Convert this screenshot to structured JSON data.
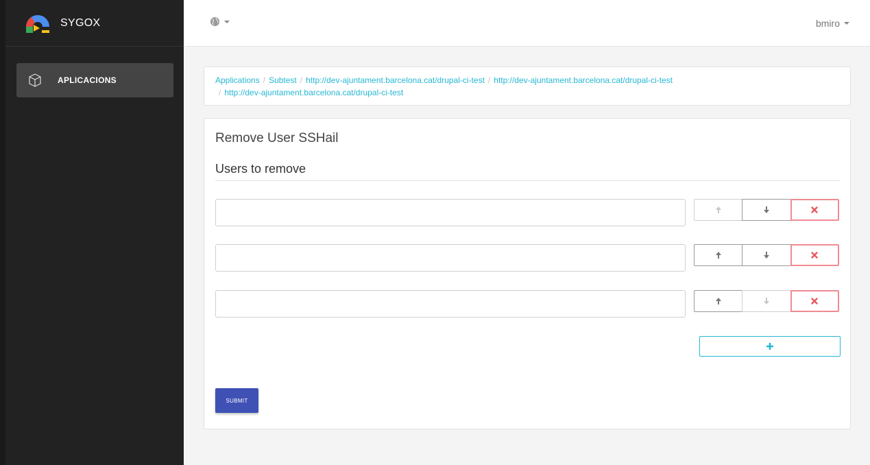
{
  "brand": {
    "name": "SYGOX"
  },
  "sidebar": {
    "items": [
      {
        "label": "APLICACIONS",
        "icon": "cube-icon"
      }
    ]
  },
  "topbar": {
    "language_icon": "globe-icon",
    "user": "bmiro"
  },
  "breadcrumb": [
    "Applications",
    "Subtest",
    "http://dev-ajuntament.barcelona.cat/drupal-ci-test",
    "http://dev-ajuntament.barcelona.cat/drupal-ci-test",
    "http://dev-ajuntament.barcelona.cat/drupal-ci-test"
  ],
  "form": {
    "title": "Remove User SSHail",
    "section": "Users to remove",
    "rows": [
      {
        "value": "",
        "up_enabled": false,
        "down_enabled": true
      },
      {
        "value": "",
        "up_enabled": true,
        "down_enabled": true
      },
      {
        "value": "",
        "up_enabled": true,
        "down_enabled": false
      }
    ],
    "submit_label": "SUBMIT"
  },
  "colors": {
    "accent": "#26b7d3",
    "danger": "#f08a92",
    "primary": "#3f51b5",
    "sidebar": "#222222"
  }
}
